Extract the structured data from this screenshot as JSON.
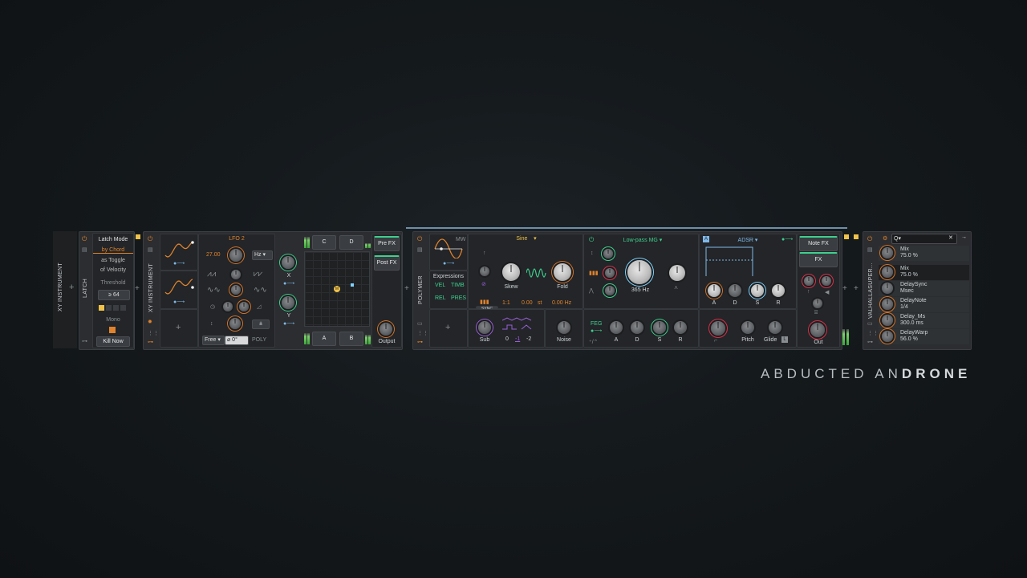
{
  "watermark": {
    "light": "ABDUCTED AN",
    "bold": "DRONE"
  },
  "track": {
    "label": "XY INSTRUMENT"
  },
  "latch": {
    "label": "LATCH",
    "mode_title": "Latch Mode",
    "mode_value": "by Chord",
    "opt1": "as Toggle",
    "opt2": "of Velocity",
    "threshold_label": "Threshold",
    "threshold_value": "≥ 64",
    "mono": "Mono",
    "kill": "Kill Now"
  },
  "xy": {
    "label": "XY INSTRUMENT",
    "lfo_title": "LFO 2",
    "lfo_rate": "27.00",
    "lfo_unit": "Hz",
    "mode_select": "Free",
    "phase": "0°",
    "poly": "POLY",
    "axis_x": "X",
    "axis_y": "Y",
    "corners": [
      "C",
      "D",
      "A",
      "B"
    ],
    "pad_marker": "M",
    "pre_fx": "Pre FX",
    "post_fx": "Post FX",
    "output": "Output"
  },
  "polymer": {
    "label": "POLYMER",
    "osc_tag": "MW",
    "expressions": "Expressions",
    "expr_tags": [
      "VEL",
      "TIMB",
      "REL",
      "PRES"
    ],
    "osc_wave": "Sine",
    "skew": "Skew",
    "fold": "Fold",
    "ratio": "1:1",
    "st": "0.00",
    "st_unit": "st",
    "hz": "0.00 Hz",
    "sub": "Sub",
    "sub_vals": [
      "0",
      "-1",
      "-2"
    ],
    "noise": "Noise",
    "sync": "SYNC",
    "filter": "Low-pass MG",
    "cutoff": "365 Hz",
    "feg": "FEG",
    "env_adsr": [
      "A",
      "D",
      "S",
      "R"
    ],
    "adsr_title": "ADSR",
    "adsr_tag": "A",
    "amp_adsr": [
      "A",
      "D",
      "S",
      "R"
    ],
    "pitch": "Pitch",
    "glide": "Glide",
    "glide_tag": "L",
    "note_fx": "Note FX",
    "fx": "FX",
    "out": "Out"
  },
  "valhalla": {
    "label": "VALHALLASUPER...",
    "search_placeholder": "Q▾",
    "params": [
      {
        "name": "Mix",
        "value": "75.0 %"
      },
      {
        "name": "Mix",
        "value": "75.0 %"
      },
      {
        "name": "DelaySync",
        "value": "Msec"
      },
      {
        "name": "DelayNote",
        "value": "1/4"
      },
      {
        "name": "Delay_Ms",
        "value": "300.0 ms"
      },
      {
        "name": "DelayWarp",
        "value": "56.0 %"
      }
    ]
  },
  "colors": {
    "accent_orange": "#e0832c",
    "accent_green": "#3fcf8e",
    "accent_blue": "#7fb9e8",
    "accent_red": "#d8324a",
    "accent_purple": "#9a5fd8"
  }
}
